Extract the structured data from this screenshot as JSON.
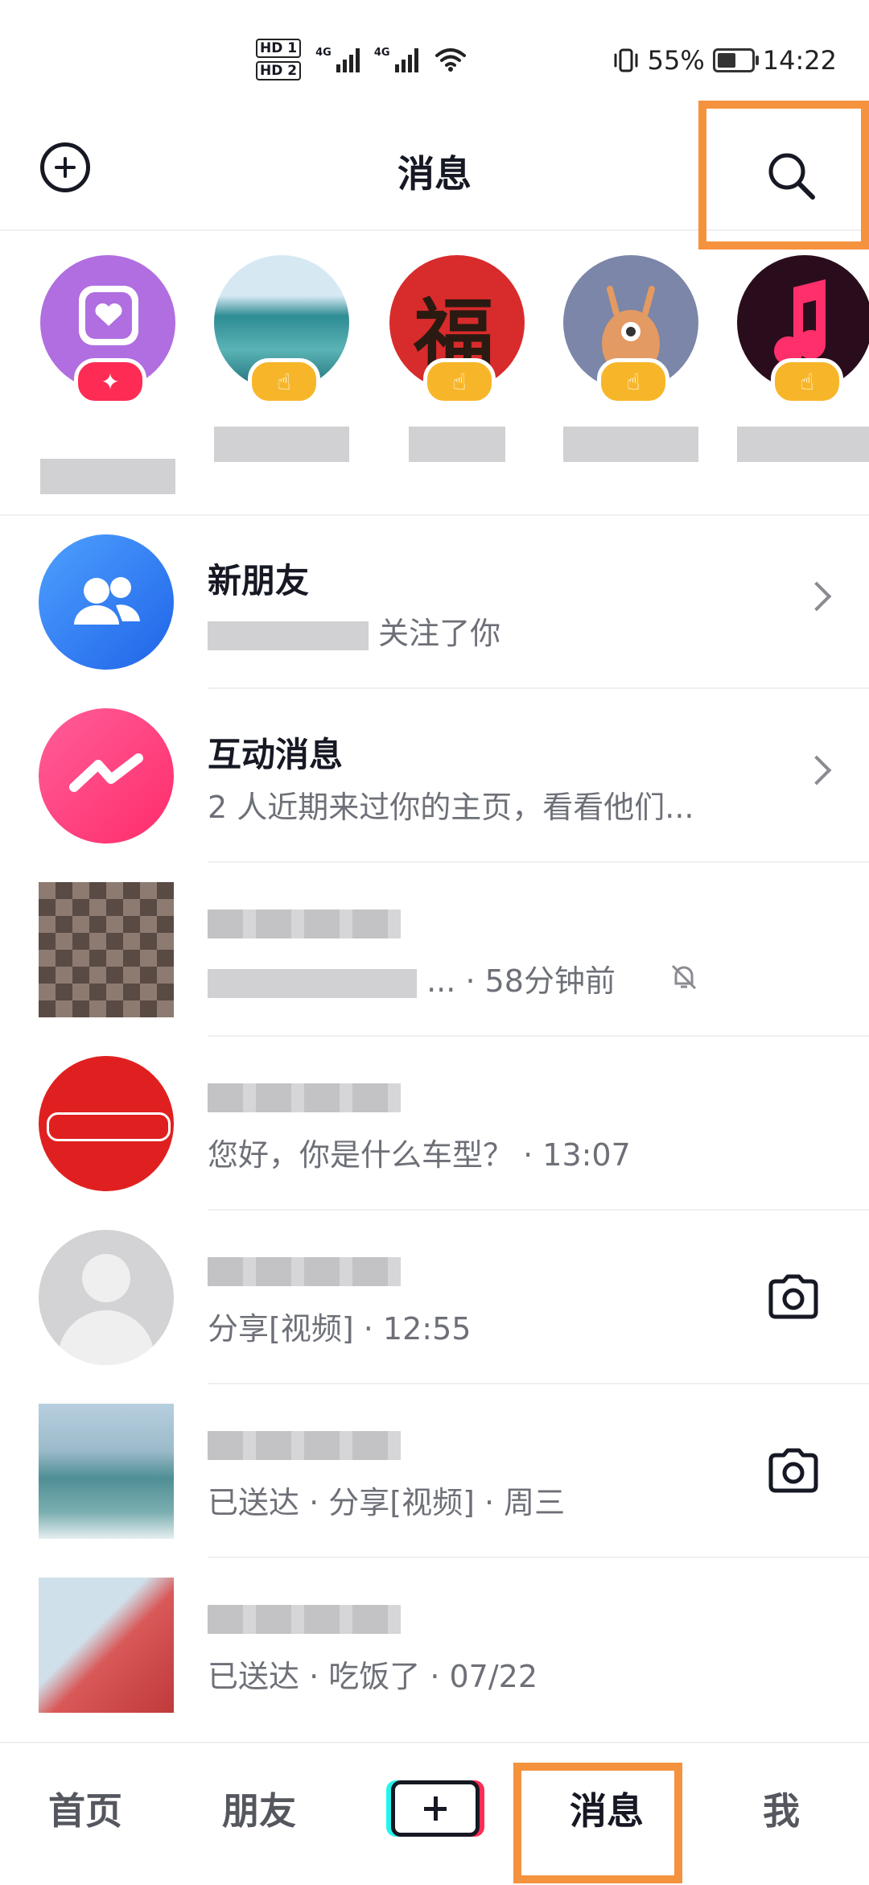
{
  "status_bar": {
    "sim1": "HD 1",
    "sim2": "HD 2",
    "net1": "4G",
    "net2": "4G",
    "battery_percent": "55%",
    "battery_level": 0.55,
    "time": "14:22"
  },
  "header": {
    "title": "消息",
    "add_icon": "plus-circle-icon",
    "search_icon": "search-icon",
    "highlight_color": "#f5923e"
  },
  "stories": [
    {
      "avatar": "heart-app-icon",
      "badge": "sparkle"
    },
    {
      "avatar": "ocean-photo",
      "badge": "hand-wave"
    },
    {
      "avatar": "fu-character",
      "badge": "hand-wave"
    },
    {
      "avatar": "cartoon-creature",
      "badge": "hand-wave"
    },
    {
      "avatar": "music-note",
      "badge": "hand-wave"
    }
  ],
  "conversations": {
    "new_friends": {
      "title": "新朋友",
      "subtitle": "关注了你"
    },
    "interactions": {
      "title": "互动消息",
      "subtitle": "2 人近期来过你的主页，看看他们..."
    },
    "chat1": {
      "preview": "...",
      "time": "· 58分钟前"
    },
    "chat2": {
      "preview": "您好，你是什么车型？",
      "time": "· 13:07"
    },
    "chat3": {
      "preview": "分享[视频]",
      "time": "· 12:55"
    },
    "chat4": {
      "preview": "已送达 · 分享[视频]",
      "time": "· 周三"
    },
    "chat5": {
      "preview": "已送达 · 吃饭了",
      "time": "· 07/22"
    }
  },
  "tabbar": {
    "home": "首页",
    "friends": "朋友",
    "messages": "消息",
    "me": "我"
  }
}
